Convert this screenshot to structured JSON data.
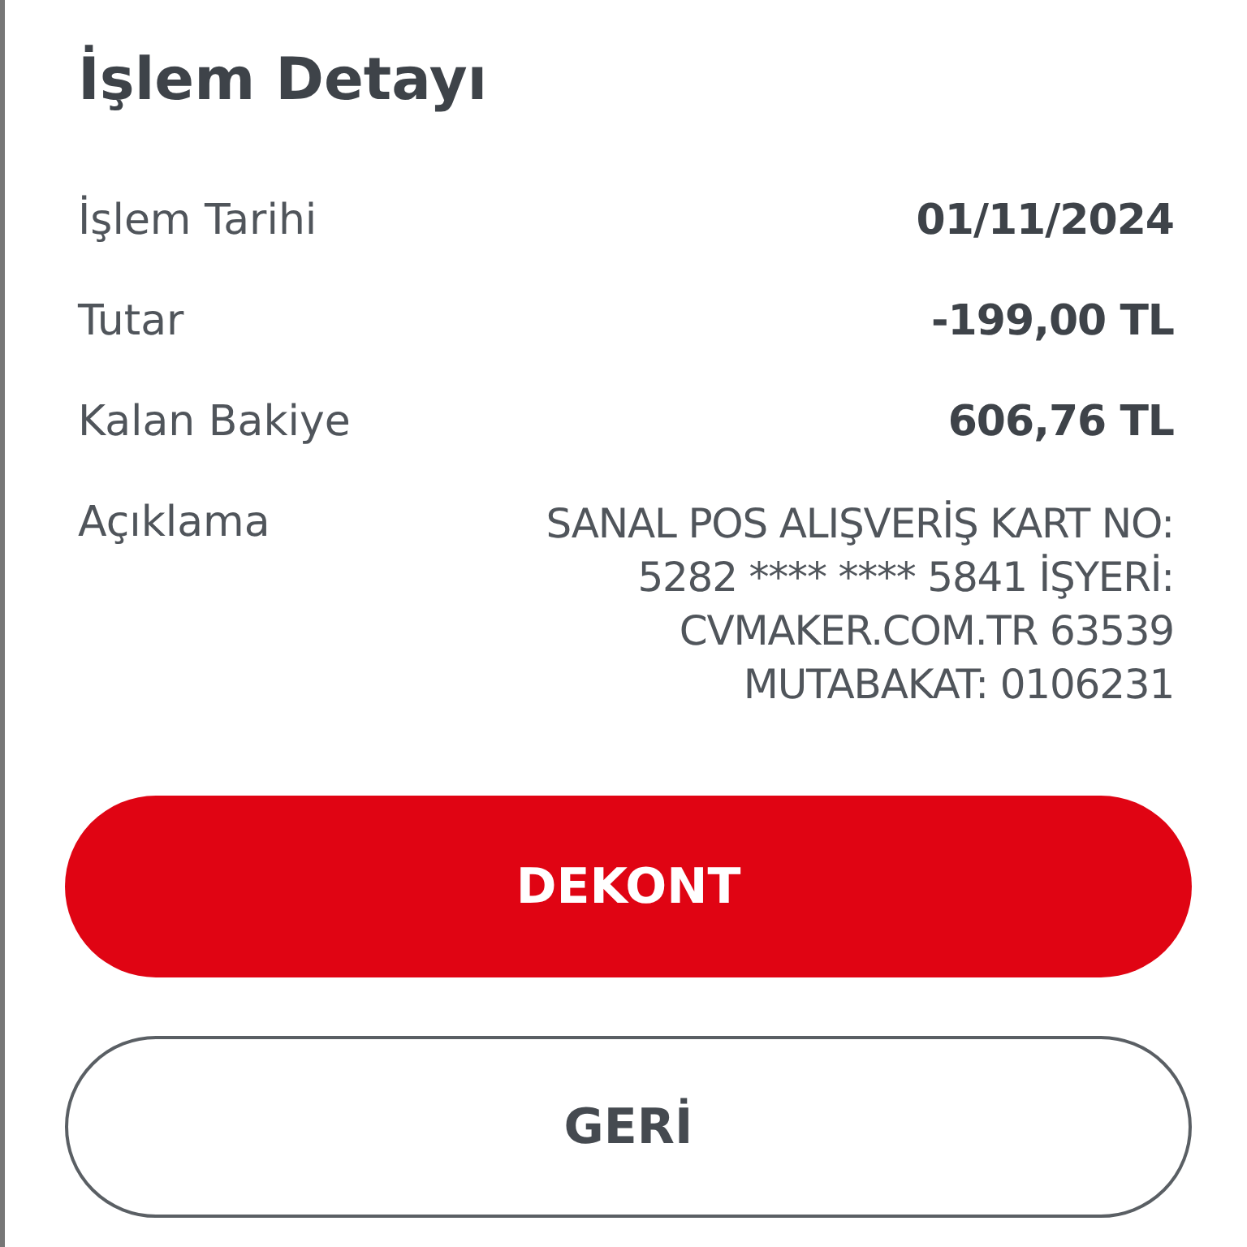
{
  "title": "İşlem Detayı",
  "rows": [
    {
      "label": "İşlem Tarihi",
      "value": "01/11/2024",
      "kind": "bold"
    },
    {
      "label": "Tutar",
      "value": "-199,00 TL",
      "kind": "bold"
    },
    {
      "label": "Kalan Bakiye",
      "value": "606,76 TL",
      "kind": "bold"
    },
    {
      "label": "Açıklama",
      "value": "SANAL POS ALIŞVERİŞ KART NO: 5282 **** **** 5841 İŞYERİ: CVMAKER.COM.TR 63539 MUTABAKAT: 0106231",
      "kind": "plain"
    }
  ],
  "buttons": [
    {
      "label": "DEKONT",
      "kind": "primary"
    },
    {
      "label": "GERİ",
      "kind": "secondary"
    }
  ]
}
